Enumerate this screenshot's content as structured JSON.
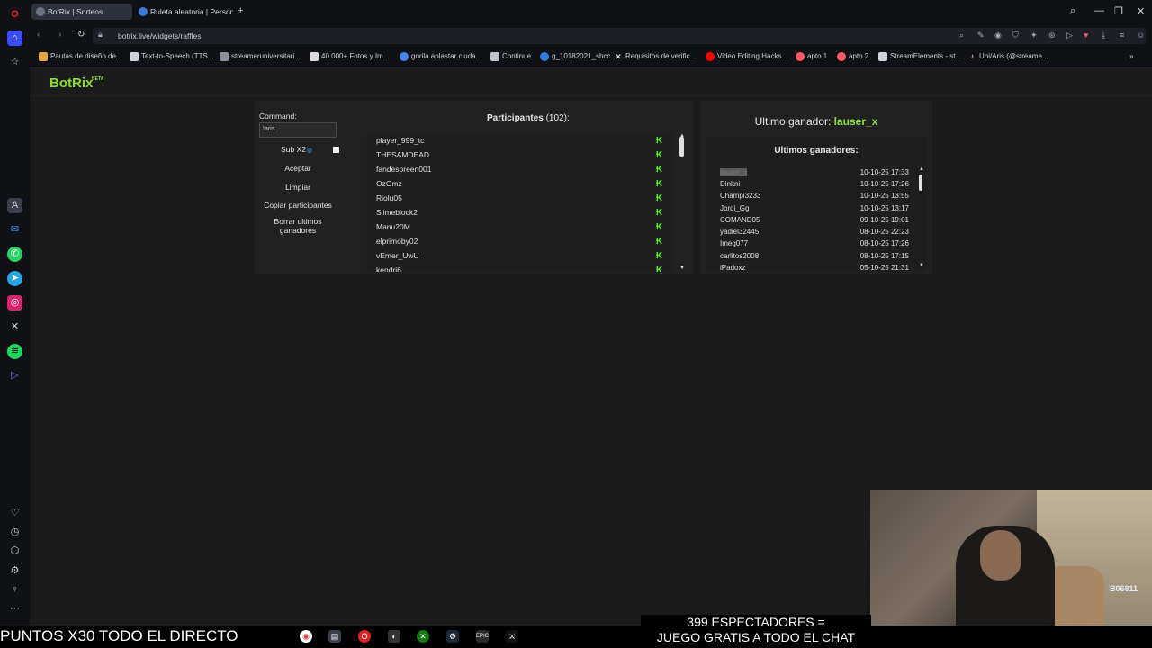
{
  "tabs": [
    {
      "label": "BotRix | Sorteos",
      "active": true
    },
    {
      "label": "Ruleta aleatoria | Personali",
      "active": false
    }
  ],
  "address": {
    "url": "botrix.live/widgets/raffles"
  },
  "bookmarks": [
    "Pautas de diseño de...",
    "Text-to-Speech (TTS...",
    "streameruniversitari...",
    "40.000+ Fotos y Im...",
    "gorila aplastar ciuda...",
    "Continue",
    "g_10182021_shcc",
    "Requisitos de verific...",
    "Video Editing Hacks...",
    "apto 1",
    "apto 2",
    "StreamElements - st...",
    "Uni/Aris (@streame..."
  ],
  "app": {
    "logo": "BotRix",
    "logo_badge": "BETA"
  },
  "raffle": {
    "command_label": "Command:",
    "command_value": "!aris",
    "sub_label": "Sub X2",
    "accept": "Aceptar",
    "clear": "Limpiar",
    "copy": "Copiar participantes",
    "delete_winners_1": "Borrar ultimos",
    "delete_winners_2": "ganadores",
    "participants_title": "Participantes",
    "participants_count": "(102):",
    "participants": [
      "player_999_tc",
      "THESAMDEAD",
      "fandespreen001",
      "OzGmz",
      "Riolu05",
      "Slimeblock2",
      "Manu20M",
      "elprimoby02",
      "vEmer_UwU",
      "kendri6"
    ],
    "badge_glyph": "K"
  },
  "winners": {
    "last_winner_label": "Ultimo ganador:",
    "last_winner": "lauser_x",
    "title": "Ultimos ganadores:",
    "rows": [
      {
        "name": "lauser_x",
        "time": "10-10-25 17:33",
        "highlighted": true
      },
      {
        "name": "Dinkni",
        "time": "10-10-25 17:26"
      },
      {
        "name": "Champi3233",
        "time": "10-10-25 13:55"
      },
      {
        "name": "Jordi_Gg",
        "time": "10-10-25 13:17"
      },
      {
        "name": "COMAND05",
        "time": "09-10-25 19:01"
      },
      {
        "name": "yadiel32445",
        "time": "08-10-25 22:23"
      },
      {
        "name": "Imeg077",
        "time": "08-10-25 17:26"
      },
      {
        "name": "carlitos2008",
        "time": "08-10-25 17:15"
      },
      {
        "name": "iPadoxz",
        "time": "05-10-25 21:31"
      }
    ]
  },
  "overlay": {
    "ticker": "PUNTOS X30 TODO EL DIRECTO",
    "viewers_line1": "399 ESPECTADORES =",
    "viewers_line2": "JUEGO GRATIS A TODO EL CHAT",
    "webcam_badge": "B06811"
  },
  "colors": {
    "accent": "#8de02b",
    "kick_green": "#53fc18"
  }
}
